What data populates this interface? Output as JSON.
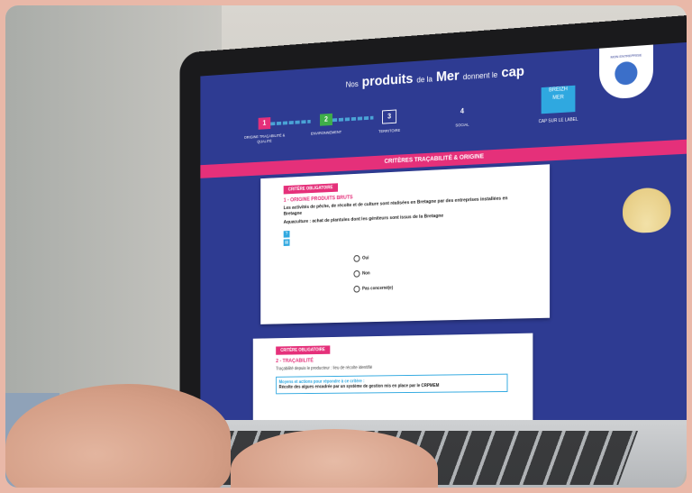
{
  "site": {
    "brand_prefix": "Nos",
    "brand_produits": "produits",
    "brand_de_la": "de la",
    "brand_mer": "Mer",
    "brand_donnent": "donnent le",
    "brand_cap": "cap",
    "badge_text": "MON ENTREPRISE"
  },
  "steps": [
    {
      "num": "1",
      "label": "ORIGINE TRAÇABILITÉ & QUALITÉ",
      "color": "#e5307a"
    },
    {
      "num": "2",
      "label": "ENVIRONNEMENT",
      "color": "#3fae49"
    },
    {
      "num": "3",
      "label": "TERRITOIRE",
      "color": "#2e3b92"
    },
    {
      "num": "4",
      "label": "SOCIAL",
      "color": "#2e3b92"
    }
  ],
  "label_block": {
    "logo_line1": "BREIZH",
    "logo_line2": "MER",
    "cap_label": "CAP SUR LE LABEL"
  },
  "section_title": "CRITÈRES TRAÇABILITÉ & ORIGINE",
  "criteria": [
    {
      "tag": "CRITÈRE OBLIGATOIRE",
      "title": "1 - ORIGINE PRODUITS BRUTS",
      "description": "Les activités de pêche, de récolte et de culture sont réalisées en Bretagne par des entreprises installées en Bretagne",
      "description2": "Aquaculture : achat de plantules dont les géniteurs sont issus de la Bretagne",
      "options": [
        "Oui",
        "Non",
        "Pas concerné(e)"
      ]
    },
    {
      "tag": "CRITÈRE OBLIGATOIRE",
      "title": "2 - TRAÇABILITÉ",
      "subtitle": "Traçabilité depuis le producteur : lieu de récolte identifié",
      "box_heading": "Moyens et actions pour répondre à ce critère :",
      "box_text": "Récolte des algues encadrée par un système de gestion mis en place par le CRPMEM"
    }
  ]
}
